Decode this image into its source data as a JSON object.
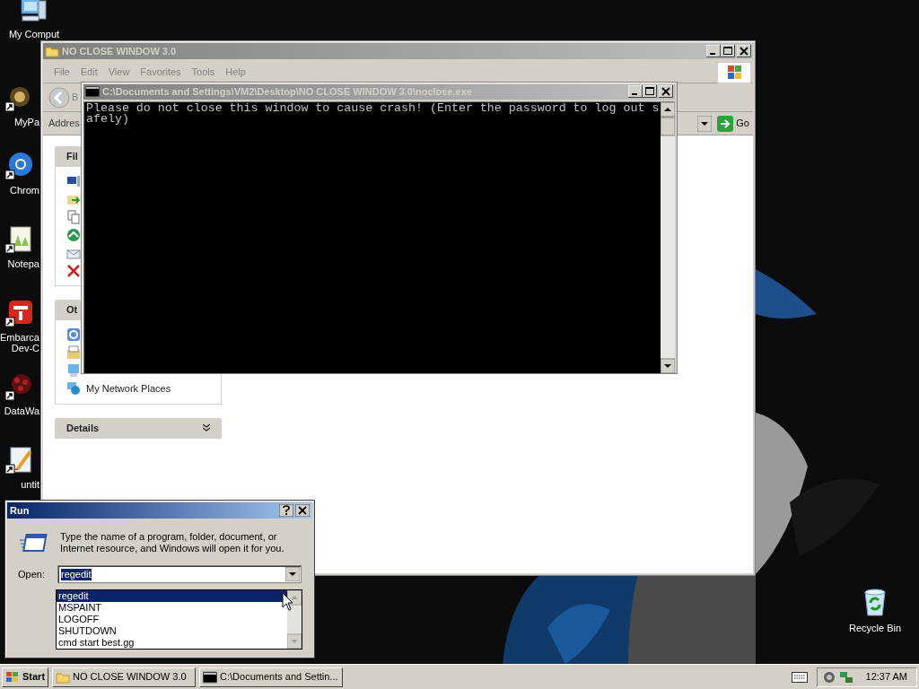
{
  "desktop_icons": [
    {
      "kind": "computer",
      "lines": [
        "My Comput"
      ]
    },
    {
      "kind": "ornament",
      "lines": [
        "MyPa"
      ]
    },
    {
      "kind": "browser",
      "lines": [
        "Chrom"
      ]
    },
    {
      "kind": "editor",
      "lines": [
        "Notepa"
      ]
    },
    {
      "kind": "dev",
      "lines": [
        "Embarca",
        "Dev-C"
      ]
    },
    {
      "kind": "net",
      "lines": [
        "DataWa"
      ]
    },
    {
      "kind": "paint",
      "lines": [
        "untit"
      ]
    }
  ],
  "recycle_bin": {
    "label": "Recycle Bin"
  },
  "explorer": {
    "title": "NO CLOSE WINDOW 3.0",
    "menu": [
      "File",
      "Edit",
      "View",
      "Favorites",
      "Tools",
      "Help"
    ],
    "back_label": "B",
    "address_label": "Addres",
    "go_label": "Go",
    "panes": [
      {
        "title": "Fil"
      },
      {
        "title": "Ot",
        "items": [
          "My Network Places"
        ]
      },
      {
        "title": "Details"
      }
    ]
  },
  "console": {
    "title": "C:\\Documents and Settings\\VM2\\Desktop\\NO CLOSE WINDOW 3.0\\noclose.exe",
    "lines": [
      "Please do not close this window to cause crash! (Enter the password to log out s",
      "afely)"
    ]
  },
  "run": {
    "title": "Run",
    "description": "Type the name of a program, folder, document, or Internet resource, and Windows will open it for you.",
    "open_label": "Open:",
    "value": "regedit",
    "history": [
      {
        "text": "regedit",
        "selected": true
      },
      {
        "text": "MSPAINT",
        "selected": false
      },
      {
        "text": "LOGOFF",
        "selected": false
      },
      {
        "text": "SHUTDOWN",
        "selected": false
      },
      {
        "text": "cmd start best.gg",
        "selected": false
      }
    ]
  },
  "taskbar": {
    "start": "Start",
    "tasks": [
      {
        "kind": "folder",
        "label": "NO CLOSE WINDOW 3.0"
      },
      {
        "kind": "console",
        "label": "C:\\Documents and Settin..."
      }
    ],
    "clock": "12:37 AM"
  }
}
